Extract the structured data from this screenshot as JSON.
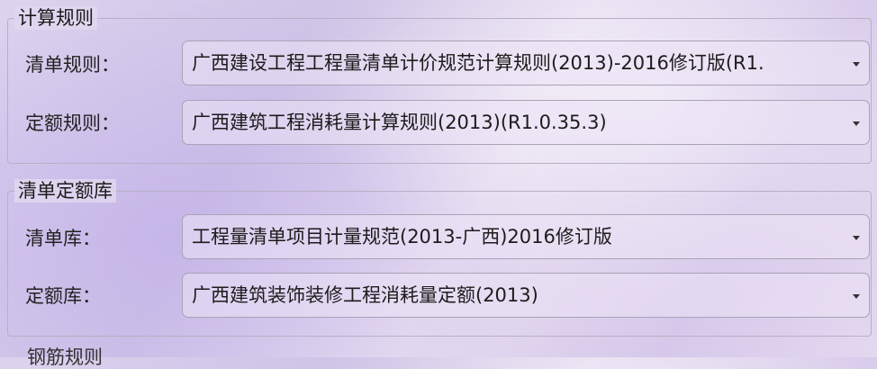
{
  "calc_rules": {
    "title": "计算规则",
    "bill_rule": {
      "label": "清单规则：",
      "value": "广西建设工程工程量清单计价规范计算规则(2013)-2016修订版(R1."
    },
    "quota_rule": {
      "label": "定额规则：",
      "value": "广西建筑工程消耗量计算规则(2013)(R1.0.35.3)"
    }
  },
  "bill_quota_lib": {
    "title": "清单定额库",
    "bill_lib": {
      "label": "清单库：",
      "value": "工程量清单项目计量规范(2013-广西)2016修订版"
    },
    "quota_lib": {
      "label": "定额库：",
      "value": "广西建筑装饰装修工程消耗量定额(2013)"
    }
  },
  "next_group": {
    "title_partial": "钢筋规则"
  },
  "icons": {
    "dropdown": "chevron-down-icon"
  }
}
